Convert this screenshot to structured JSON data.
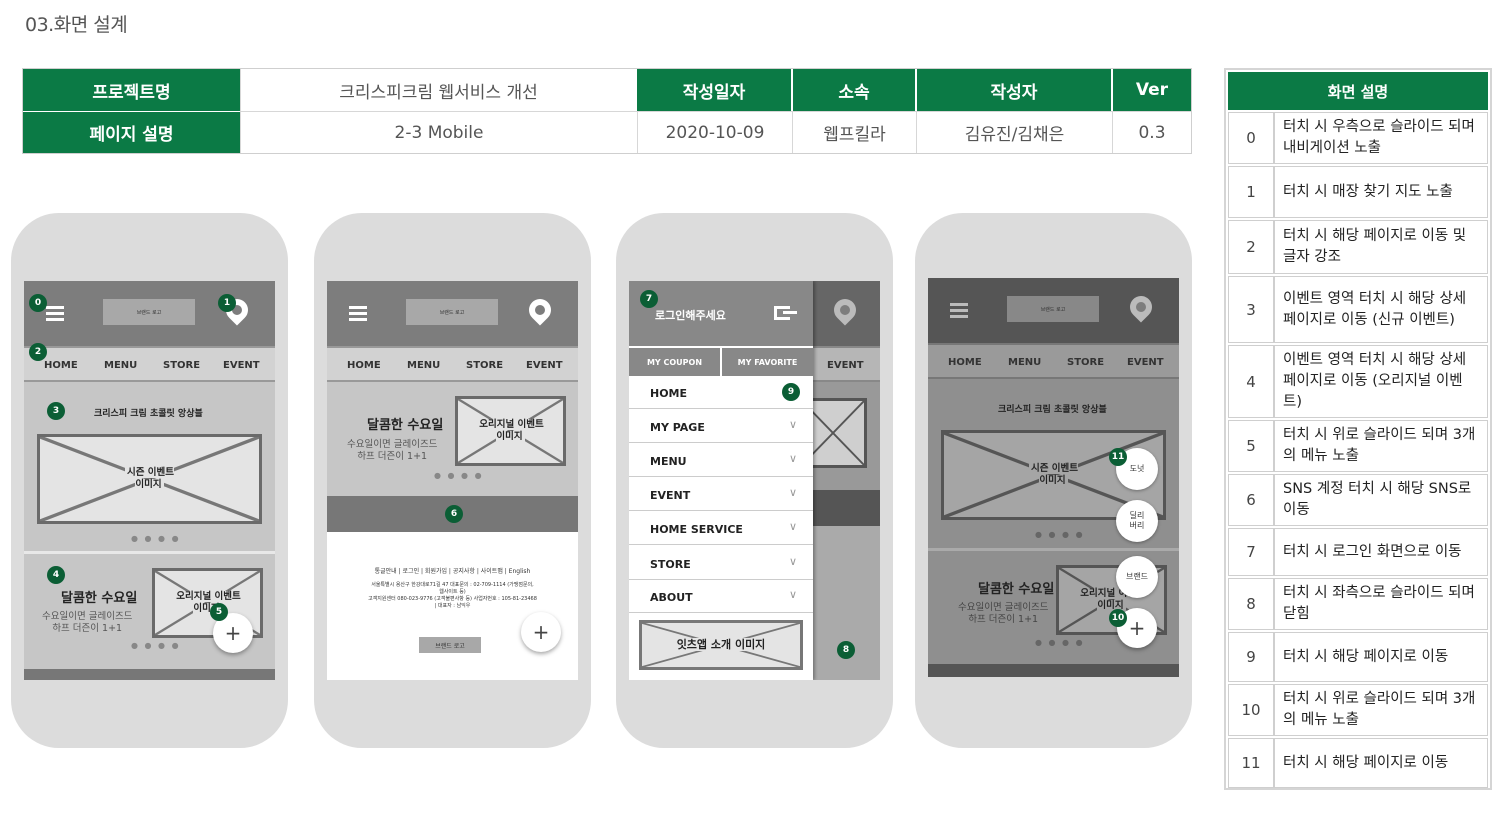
{
  "page_title": "03.화면 설계",
  "header_table": {
    "project_label": "프로젝트명",
    "project_value": "크리스피크림 웹서비스 개선",
    "page_label": "페이지 설명",
    "page_value": "2-3 Mobile",
    "date_label": "작성일자",
    "date_value": "2020-10-09",
    "org_label": "소속",
    "org_value": "웹프킬라",
    "author_label": "작성자",
    "author_value": "김유진/김채은",
    "ver_label": "Ver",
    "ver_value": "0.3"
  },
  "desc_table": {
    "header": "화면 설명",
    "rows": [
      {
        "num": "0",
        "text": "터치 시 우측으로 슬라이드 되며 내비게이션 노출"
      },
      {
        "num": "1",
        "text": "터치 시 매장 찾기 지도 노출"
      },
      {
        "num": "2",
        "text": "터치 시 해당 페이지로 이동 및 글자 강조"
      },
      {
        "num": "3",
        "text": "이벤트 영역 터치 시 해당 상세 페이지로 이동 (신규 이벤트)"
      },
      {
        "num": "4",
        "text": "이벤트 영역 터치 시 해당 상세 페이지로 이동 (오리지널 이벤트)"
      },
      {
        "num": "5",
        "text": "터치 시 위로 슬라이드 되며 3개의 메뉴 노출"
      },
      {
        "num": "6",
        "text": "SNS 계정 터치 시 해당 SNS로 이동"
      },
      {
        "num": "7",
        "text": "터치 시 로그인 화면으로 이동"
      },
      {
        "num": "8",
        "text": "터치 시 좌측으로 슬라이드 되며 닫힘"
      },
      {
        "num": "9",
        "text": "터치 시 해당 페이지로 이동"
      },
      {
        "num": "10",
        "text": "터치 시 위로 슬라이드 되며 3개의 메뉴 노출"
      },
      {
        "num": "11",
        "text": "터치 시 해당 페이지로 이동"
      }
    ]
  },
  "mock": {
    "logo": "브랜드 로고",
    "nav": [
      "HOME",
      "MENU",
      "STORE",
      "EVENT"
    ],
    "section_title": "크리스피 크림 초콜릿 앙상블",
    "season_event": "시즌 이벤트\n이미지",
    "original_event": "오리지널 이벤트\n이미지",
    "wednesday_title": "달콤한 수요일",
    "wednesday_sub": "수요일이면 글레이즈드\n하프 더즌이 1+1",
    "dots": "● ● ● ●",
    "plus": "+",
    "footer_links": "통글안내 | 로그인 | 회원가입 | 공지사항 | 사이트맵 | English",
    "footer_info_1": "서울특별시 용산구 한강대로71길 47 대표문의 : 02-709-1114 (가맹점문의,",
    "footer_info_2": "웹사이트 등)",
    "footer_info_3": "고객지원센터 080-023-9776 (고객불편사항 등) 사업자번호 : 105-81-23468",
    "footer_info_4": "| 대표자 : 남익우",
    "login_prompt": "로그인해주세요",
    "my_coupon": "MY COUPON",
    "my_favorite": "MY FAVORITE",
    "menu_items": [
      "HOME",
      "MY PAGE",
      "MENU",
      "EVENT",
      "HOME SERVICE",
      "STORE",
      "ABOUT"
    ],
    "chevron": "∨",
    "app_banner": "잇츠앱 소개 이미지",
    "fab_walk": "도넛",
    "fab_delivery": "딜리\n버리",
    "fab_brand": "브랜드",
    "badges": [
      "0",
      "1",
      "2",
      "3",
      "4",
      "5",
      "6",
      "7",
      "8",
      "9",
      "10",
      "11"
    ]
  }
}
